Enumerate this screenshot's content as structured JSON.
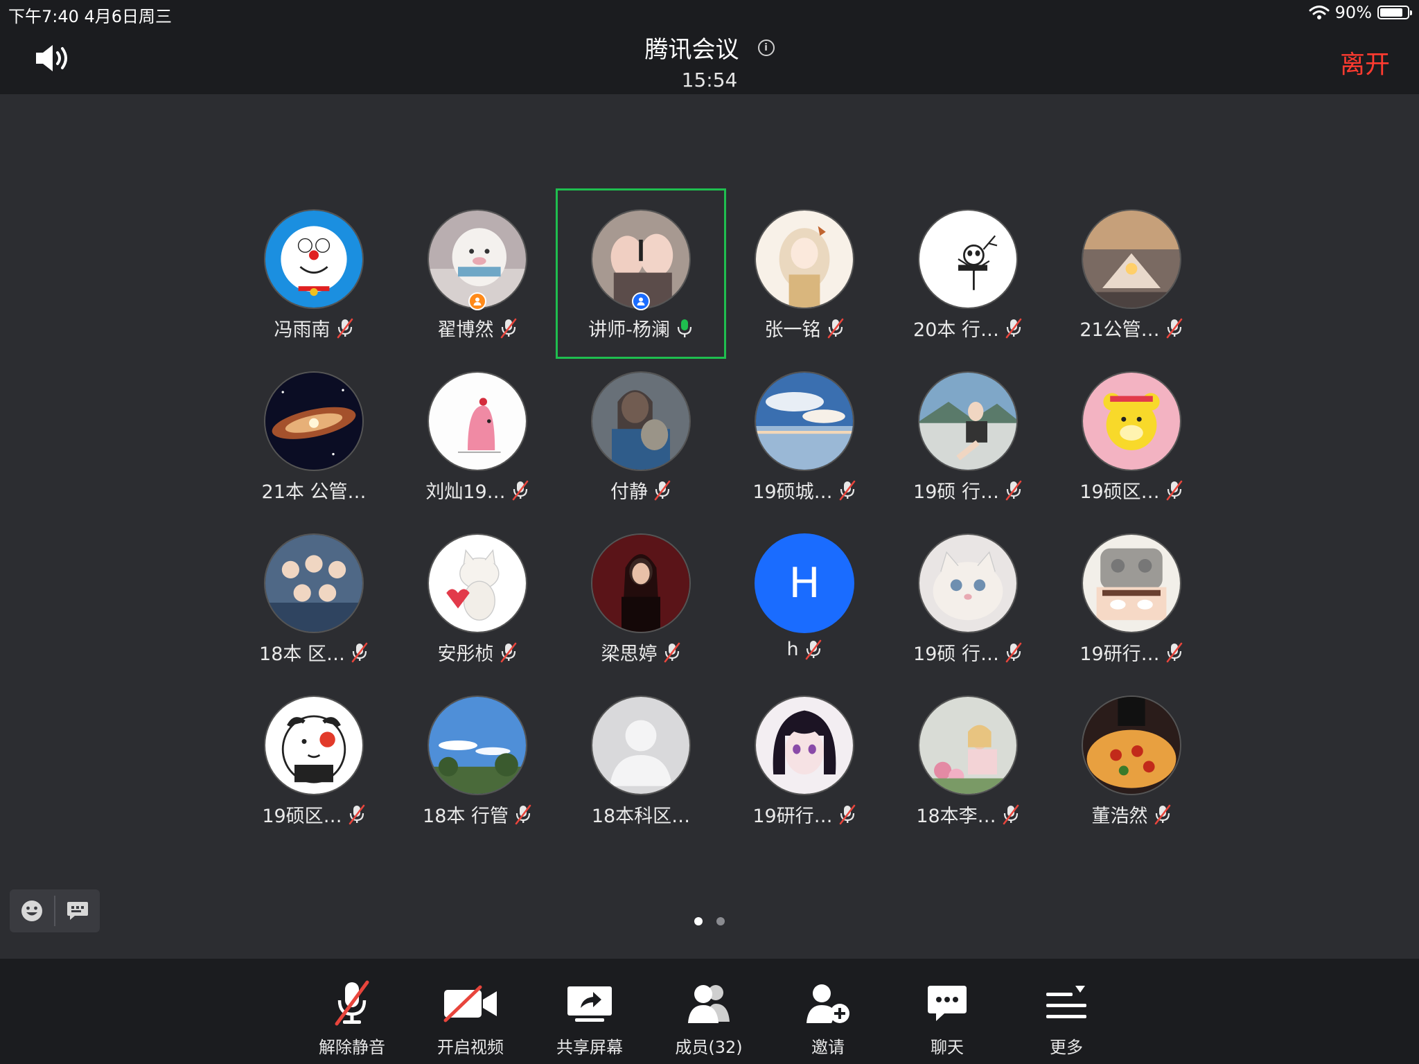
{
  "status": {
    "time_date": "下午7:40   4月6日周三",
    "battery": "90%",
    "battery_level": 0.9
  },
  "header": {
    "title": "腾讯会议",
    "duration": "15:54",
    "leave": "离开"
  },
  "participants": [
    {
      "name": "冯雨南",
      "mic": "muted",
      "avatar": "doraemon"
    },
    {
      "name": "翟博然",
      "mic": "muted",
      "avatar": "pig",
      "badge": "orange"
    },
    {
      "name": "讲师-杨澜",
      "mic": "on",
      "avatar": "hands",
      "badge": "blue",
      "active": true
    },
    {
      "name": "张一铭",
      "mic": "muted",
      "avatar": "girl-art"
    },
    {
      "name": "20本 行…",
      "mic": "muted",
      "avatar": "panda"
    },
    {
      "name": "21公管…",
      "mic": "muted",
      "avatar": "sunset-hands"
    },
    {
      "name": "21本 公管…",
      "mic": "none",
      "avatar": "galaxy"
    },
    {
      "name": "刘灿19…",
      "mic": "muted",
      "avatar": "pink-bird"
    },
    {
      "name": "付静",
      "mic": "muted",
      "avatar": "girl-cat"
    },
    {
      "name": "19硕城…",
      "mic": "muted",
      "avatar": "sky"
    },
    {
      "name": "19硕 行…",
      "mic": "muted",
      "avatar": "outdoor-girl"
    },
    {
      "name": "19硕区…",
      "mic": "muted",
      "avatar": "bear"
    },
    {
      "name": "18本 区…",
      "mic": "muted",
      "avatar": "group"
    },
    {
      "name": "安彤桢",
      "mic": "muted",
      "avatar": "white-cat"
    },
    {
      "name": "梁思婷",
      "mic": "muted",
      "avatar": "dark-girl"
    },
    {
      "name": "h",
      "mic": "muted",
      "avatar": "letter",
      "letter": "H"
    },
    {
      "name": "19硕 行…",
      "mic": "muted",
      "avatar": "fluffy-cat"
    },
    {
      "name": "19研行…",
      "mic": "muted",
      "avatar": "cartoon-hat"
    },
    {
      "name": "19硕区…",
      "mic": "muted",
      "avatar": "lucky-cat"
    },
    {
      "name": "18本 行管",
      "mic": "muted",
      "avatar": "blue-sky"
    },
    {
      "name": "18本科区…",
      "mic": "none",
      "avatar": "default"
    },
    {
      "name": "19研行…",
      "mic": "muted",
      "avatar": "anime-girl"
    },
    {
      "name": "18本李…",
      "mic": "muted",
      "avatar": "flower-girl"
    },
    {
      "name": "董浩然",
      "mic": "muted",
      "avatar": "pizza"
    }
  ],
  "pagination": {
    "pages": 2,
    "current": 1
  },
  "toolbar": {
    "unmute": "解除静音",
    "video": "开启视频",
    "share": "共享屏幕",
    "members": "成员(32)",
    "invite": "邀请",
    "chat": "聊天",
    "more": "更多"
  },
  "colors": {
    "accent_green": "#1fbe4f",
    "leave_red": "#ff3b30",
    "mute_red": "#e8453c",
    "letter_avatar_blue": "#1a6cff"
  }
}
